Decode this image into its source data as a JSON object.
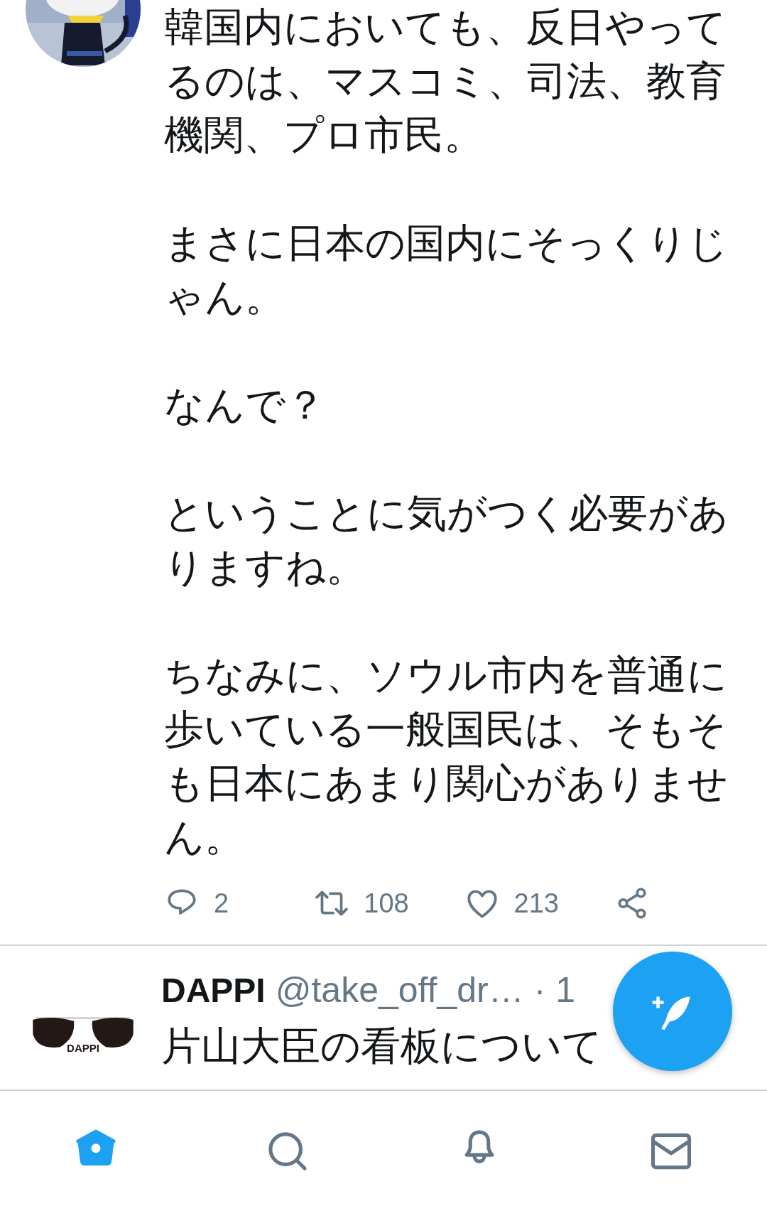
{
  "tweet": {
    "paragraphs": [
      "韓国内においても、反日やってるのは、マスコミ、司法、教育機関、プロ市民。",
      "まさに日本の国内にそっくりじゃん。",
      "なんで？",
      "ということに気がつく必要がありますね。",
      "ちなみに、ソウル市内を普通に歩いている一般国民は、そもそも日本にあまり関心がありません。"
    ],
    "actions": [
      {
        "kind": "reply",
        "count": "2"
      },
      {
        "kind": "retweet",
        "count": "108"
      },
      {
        "kind": "like",
        "count": "213"
      },
      {
        "kind": "share"
      }
    ]
  },
  "next_tweet": {
    "avatar_text": "DAPPI",
    "name": "DAPPI",
    "handle": "@take_off_dr…",
    "time": "· 1",
    "text": "片山大臣の看板について"
  },
  "nav": [
    {
      "kind": "home",
      "selected": true
    },
    {
      "kind": "search",
      "selected": false
    },
    {
      "kind": "notifications",
      "selected": false
    },
    {
      "kind": "messages",
      "selected": false
    }
  ]
}
